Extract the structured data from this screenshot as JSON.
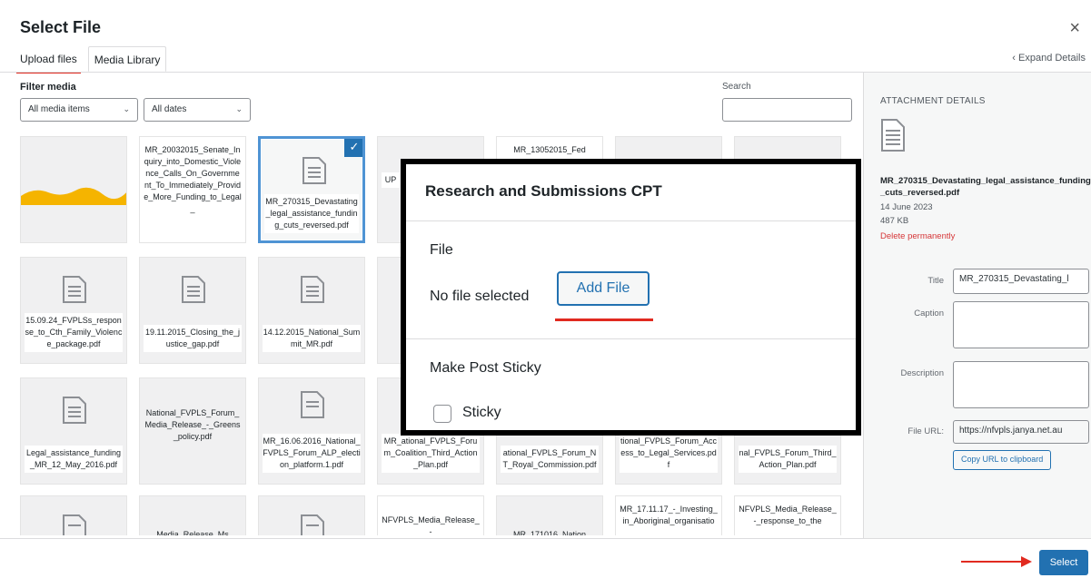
{
  "header": {
    "title": "Select File",
    "close_glyph": "×",
    "expand_details": "‹ Expand Details"
  },
  "tabs": [
    {
      "label": "Upload files"
    },
    {
      "label": "Media Library"
    }
  ],
  "filters": {
    "label": "Filter media",
    "media_type": "All media items",
    "dates": "All dates",
    "search_label": "Search"
  },
  "grid_items": [
    {
      "label": "",
      "kind": "image"
    },
    {
      "label": "MR_20032015_Senate_Inquiry_into_Domestic_Violence_Calls_On_Government_To_Immediately_Provide_More_Funding_to_Legal_",
      "kind": "text"
    },
    {
      "label": "MR_270315_Devastating_legal_assistance_funding_cuts_reversed.pdf",
      "kind": "doc",
      "selected": true
    },
    {
      "label": "UP",
      "kind": "doc"
    },
    {
      "label": "MR_13052015_Fed",
      "kind": "text"
    },
    {
      "label": "",
      "kind": "doc"
    },
    {
      "label": "",
      "kind": "doc"
    },
    {
      "label": "15.09.24_FVPLSs_response_to_Cth_Family_Violence_package.pdf",
      "kind": "doc"
    },
    {
      "label": "19.11.2015_Closing_the_justice_gap.pdf",
      "kind": "doc"
    },
    {
      "label": "14.12.2015_National_Summit_MR.pdf",
      "kind": "doc"
    },
    {
      "label": "Legal_assistance_funding_MR_12_May_2016.pdf",
      "kind": "doc"
    },
    {
      "label": "National_FVPLS_Forum_Media_Release_-_Greens_policy.pdf",
      "kind": "doc"
    },
    {
      "label": "MR_16.06.2016_National_FVPLS_Forum_ALP_election_platform.1.pdf",
      "kind": "doc"
    },
    {
      "label": "MR_ational_FVPLS_Forum_Coalition_Third_Action_Plan.pdf",
      "kind": "doc"
    },
    {
      "label": "ational_FVPLS_Forum_NT_Royal_Commission.pdf",
      "kind": "doc"
    },
    {
      "label": "tional_FVPLS_Forum_Access_to_Legal_Services.pdf",
      "kind": "doc"
    },
    {
      "label": "nal_FVPLS_Forum_Third_Action_Plan.pdf",
      "kind": "doc"
    },
    {
      "label": "",
      "kind": "doc"
    },
    {
      "label": "Media_Release_Ms",
      "kind": "doc"
    },
    {
      "label": "",
      "kind": "doc"
    },
    {
      "label": "NFVPLS_Media_Release_-",
      "kind": "doc"
    },
    {
      "label": "MR_171016_Nation",
      "kind": "doc"
    },
    {
      "label": "MR_17.11.17_-_Investing_in_Aboriginal_organisatio",
      "kind": "text"
    },
    {
      "label": "NFVPLS_Media_Release_-_response_to_the",
      "kind": "text"
    }
  ],
  "details": {
    "heading": "ATTACHMENT DETAILS",
    "filename": "MR_270315_Devastating_legal_assistance_funding_cuts_reversed.pdf",
    "date": "14 June 2023",
    "size": "487 KB",
    "delete": "Delete permanently",
    "title_label": "Title",
    "title_value": "MR_270315_Devastating_l",
    "caption_label": "Caption",
    "description_label": "Description",
    "url_label": "File URL:",
    "url_value": "https://nfvpls.janya.net.au",
    "copy_label": "Copy URL to clipboard"
  },
  "footer": {
    "select_label": "Select"
  },
  "overlay": {
    "title": "Research and Submissions CPT",
    "file_label": "File",
    "no_file": "No file selected",
    "add_file": "Add File",
    "sticky_section": "Make Post Sticky",
    "sticky_label": "Sticky"
  },
  "colors": {
    "accent": "#2271b1",
    "danger": "#d63638",
    "highlight_red": "#e12a20",
    "thumbnail_wave": "#f5b400"
  }
}
